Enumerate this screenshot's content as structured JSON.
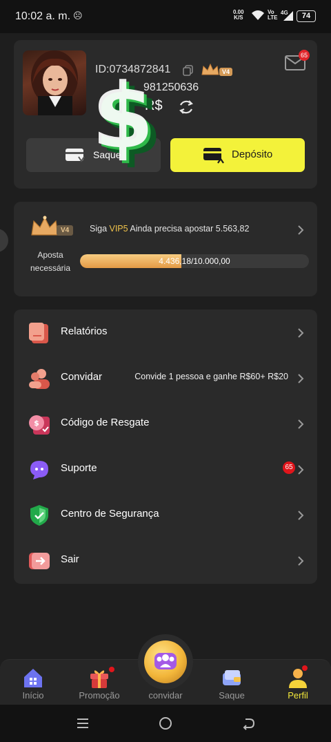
{
  "status_bar": {
    "time": "10:02 a. m.",
    "notification_icon": "ghost-icon",
    "net_speed_value": "0.00",
    "net_speed_unit": "K/S",
    "volte_top": "Vo",
    "volte_bottom": "LTE",
    "network": "4G",
    "battery": "74"
  },
  "profile": {
    "id_label": "ID:",
    "id_value": "0734872841",
    "vip_badge": "V4",
    "phone": "981250636",
    "balance": "R$",
    "mail_badge": "65",
    "withdraw_label": "Saque",
    "deposit_label": "Depósito"
  },
  "vip": {
    "badge": "V4",
    "requirement_label_1": "Aposta",
    "requirement_label_2": "necessária",
    "prefix": "Siga ",
    "next_level": "VIP5",
    "suffix": " Ainda precisa apostar 5.563,82",
    "progress_text": "4.436,18/10.000,00",
    "progress_value": 4436.18,
    "progress_max": 10000
  },
  "menu": {
    "items": [
      {
        "label": "Relatórios",
        "icon": "report-icon",
        "extra": "",
        "badge": ""
      },
      {
        "label": "Convidar",
        "icon": "invite-people-icon",
        "extra": "Convide 1 pessoa e ganhe R$60+ R$20",
        "badge": ""
      },
      {
        "label": "Código de Resgate",
        "icon": "redeem-code-icon",
        "extra": "",
        "badge": ""
      },
      {
        "label": "Suporte",
        "icon": "support-chat-icon",
        "extra": "",
        "badge": "65"
      },
      {
        "label": "Centro de Segurança",
        "icon": "shield-icon",
        "extra": "",
        "badge": ""
      },
      {
        "label": "Sair",
        "icon": "logout-icon",
        "extra": "",
        "badge": ""
      }
    ]
  },
  "bottom_nav": {
    "items": [
      {
        "label": "Início",
        "icon": "home-icon"
      },
      {
        "label": "Promoção",
        "icon": "gift-icon"
      },
      {
        "label": "convidar",
        "icon": "invite-group-icon"
      },
      {
        "label": "Saque",
        "icon": "wallet-icon"
      },
      {
        "label": "Perfil",
        "icon": "profile-icon"
      }
    ],
    "active": "Perfil",
    "active_color": "#f3e83a"
  },
  "colors": {
    "accent_yellow": "#f3f23a",
    "vip_gold": "#f0c34b",
    "badge_red": "#e0151b",
    "background": "#1e1e1e",
    "card": "#2a2a2a"
  }
}
